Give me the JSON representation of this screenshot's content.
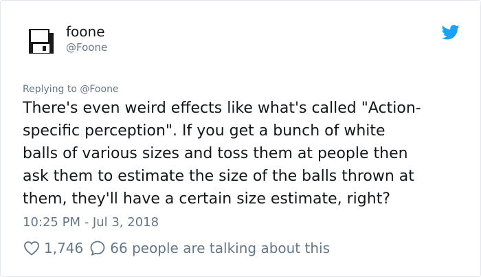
{
  "user": {
    "name": "foone",
    "handle": "@Foone",
    "avatar_icon": "floppy-disk-icon"
  },
  "brand": {
    "icon": "twitter-bird-icon",
    "color": "#1da1f2"
  },
  "replying_to": "Replying to @Foone",
  "tweet": {
    "lines": [
      "There's even weird effects like what's called \"Action-",
      "specific perception\". If you get a bunch of white",
      "balls of various sizes and toss them at people then",
      "ask them to estimate the size of the balls thrown at",
      "them, they'll have a certain size estimate, right?"
    ],
    "timestamp": "10:25 PM - Jul 3, 2018"
  },
  "engagement": {
    "like_count": "1,746",
    "like_icon": "heart-icon",
    "reply_icon": "speech-bubble-icon",
    "talking_text": "66 people are talking about this"
  },
  "colors": {
    "text": "#14171a",
    "secondary": "#657786",
    "border": "#e1e8ed"
  }
}
